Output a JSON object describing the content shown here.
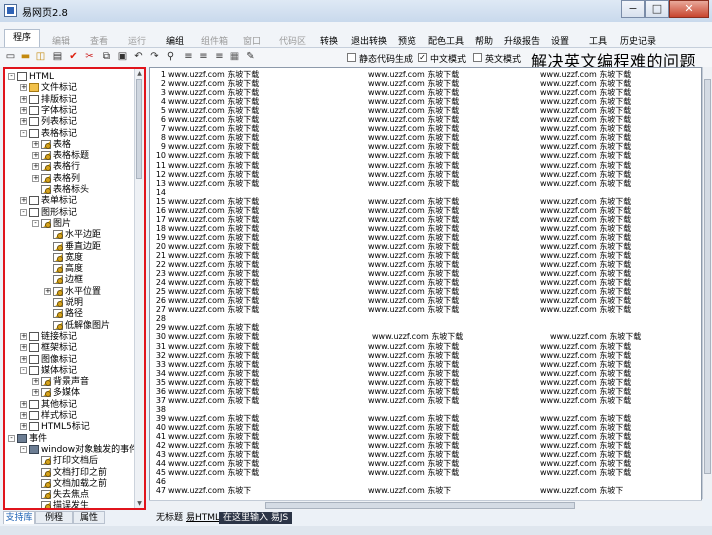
{
  "window": {
    "title": "易网页2.8",
    "min": "−",
    "max": "□",
    "close": "✕"
  },
  "menubar": {
    "prog_tab": "程序",
    "items": [
      {
        "label": "编辑",
        "disabled": true
      },
      {
        "label": "查看",
        "disabled": true
      },
      {
        "label": "运行",
        "disabled": true
      },
      {
        "label": "编组",
        "disabled": false
      },
      {
        "label": "组件箱",
        "disabled": true
      },
      {
        "label": "窗口",
        "disabled": true
      },
      {
        "label": "代码区",
        "disabled": true
      },
      {
        "label": "转换",
        "disabled": false
      },
      {
        "label": "退出转换",
        "disabled": false
      },
      {
        "label": "预览",
        "disabled": false
      },
      {
        "label": "配色工具",
        "disabled": false
      },
      {
        "label": "帮助",
        "disabled": false
      },
      {
        "label": "升级报告",
        "disabled": false
      },
      {
        "label": "设置",
        "disabled": false
      },
      {
        "label": "工具",
        "disabled": false
      },
      {
        "label": "历史记录",
        "disabled": false
      }
    ]
  },
  "toolbar": {
    "icons": [
      "new-file-icon",
      "open-folder-icon",
      "open-icon",
      "save-icon",
      "check-icon",
      "cut-icon",
      "copy-icon",
      "paste-icon",
      "undo-icon",
      "redo-icon",
      "find-icon",
      "align-left-icon",
      "align-center-icon",
      "align-right-icon",
      "grid-icon",
      "edit-icon"
    ],
    "options": [
      {
        "label": "静态代码生成",
        "checked": false
      },
      {
        "label": "中文模式",
        "checked": true
      },
      {
        "label": "英文模式",
        "checked": false
      }
    ],
    "banner": "解决英文编程难的问题"
  },
  "tree": [
    {
      "label": "HTML",
      "depth": 0,
      "exp": "-",
      "icon": "doc"
    },
    {
      "label": "文件标记",
      "depth": 1,
      "exp": "+",
      "icon": "folder"
    },
    {
      "label": "排版标记",
      "depth": 1,
      "exp": "+",
      "icon": "doc"
    },
    {
      "label": "字体标记",
      "depth": 1,
      "exp": "+",
      "icon": "doc"
    },
    {
      "label": "列表标记",
      "depth": 1,
      "exp": "+",
      "icon": "doc"
    },
    {
      "label": "表格标记",
      "depth": 1,
      "exp": "-",
      "icon": "doc"
    },
    {
      "label": "表格",
      "depth": 2,
      "exp": "+",
      "icon": "tag"
    },
    {
      "label": "表格标题",
      "depth": 2,
      "exp": "+",
      "icon": "tag"
    },
    {
      "label": "表格行",
      "depth": 2,
      "exp": "+",
      "icon": "tag"
    },
    {
      "label": "表格列",
      "depth": 2,
      "exp": "+",
      "icon": "tag"
    },
    {
      "label": "表格标头",
      "depth": 2,
      "exp": "",
      "icon": "tag"
    },
    {
      "label": "表单标记",
      "depth": 1,
      "exp": "+",
      "icon": "doc"
    },
    {
      "label": "图形标记",
      "depth": 1,
      "exp": "-",
      "icon": "doc"
    },
    {
      "label": "图片",
      "depth": 2,
      "exp": "-",
      "icon": "tag"
    },
    {
      "label": "水平边距",
      "depth": 3,
      "exp": "",
      "icon": "tag"
    },
    {
      "label": "垂直边距",
      "depth": 3,
      "exp": "",
      "icon": "tag"
    },
    {
      "label": "宽度",
      "depth": 3,
      "exp": "",
      "icon": "tag"
    },
    {
      "label": "高度",
      "depth": 3,
      "exp": "",
      "icon": "tag"
    },
    {
      "label": "边框",
      "depth": 3,
      "exp": "",
      "icon": "tag"
    },
    {
      "label": "水平位置",
      "depth": 3,
      "exp": "+",
      "icon": "tag"
    },
    {
      "label": "说明",
      "depth": 3,
      "exp": "",
      "icon": "tag"
    },
    {
      "label": "路径",
      "depth": 3,
      "exp": "",
      "icon": "tag"
    },
    {
      "label": "低解像图片",
      "depth": 3,
      "exp": "",
      "icon": "tag"
    },
    {
      "label": "链接标记",
      "depth": 1,
      "exp": "+",
      "icon": "doc"
    },
    {
      "label": "框架标记",
      "depth": 1,
      "exp": "+",
      "icon": "doc"
    },
    {
      "label": "图像标记",
      "depth": 1,
      "exp": "+",
      "icon": "doc"
    },
    {
      "label": "媒体标记",
      "depth": 1,
      "exp": "-",
      "icon": "doc"
    },
    {
      "label": "背景声音",
      "depth": 2,
      "exp": "+",
      "icon": "tag"
    },
    {
      "label": "多媒体",
      "depth": 2,
      "exp": "+",
      "icon": "tag"
    },
    {
      "label": "其他标记",
      "depth": 1,
      "exp": "+",
      "icon": "doc"
    },
    {
      "label": "样式标记",
      "depth": 1,
      "exp": "+",
      "icon": "doc"
    },
    {
      "label": "HTML5标记",
      "depth": 1,
      "exp": "+",
      "icon": "doc"
    },
    {
      "label": "事件",
      "depth": 0,
      "exp": "-",
      "icon": "event"
    },
    {
      "label": "window对象触发的事件",
      "depth": 1,
      "exp": "-",
      "icon": "event"
    },
    {
      "label": "打印文档后",
      "depth": 2,
      "exp": "",
      "icon": "tag"
    },
    {
      "label": "文档打印之前",
      "depth": 2,
      "exp": "",
      "icon": "tag"
    },
    {
      "label": "文档加载之前",
      "depth": 2,
      "exp": "",
      "icon": "tag"
    },
    {
      "label": "失去焦点",
      "depth": 2,
      "exp": "",
      "icon": "tag"
    },
    {
      "label": "描误发生",
      "depth": 2,
      "exp": "",
      "icon": "tag"
    }
  ],
  "left_tabs": [
    "支持库",
    "例程",
    "属性"
  ],
  "editor": {
    "text": "www.uzzf.com 东坡下载",
    "short": "www.uzzf.com 东坡下",
    "lines": [
      "1",
      "2",
      "3",
      "4",
      "5",
      "6",
      "7",
      "8",
      "9",
      "10",
      "11",
      "12",
      "13",
      "14",
      "15",
      "16",
      "17",
      "18",
      "19",
      "20",
      "21",
      "22",
      "23",
      "24",
      "25",
      "26",
      "27",
      "28",
      "29",
      "30",
      "31",
      "32",
      "33",
      "34",
      "35",
      "36",
      "37",
      "38",
      "39",
      "40",
      "41",
      "42",
      "43",
      "44",
      "45",
      "46",
      "47"
    ]
  },
  "editor_tabs": [
    "无标题",
    "易HTML",
    "在这里输入 易JS"
  ]
}
